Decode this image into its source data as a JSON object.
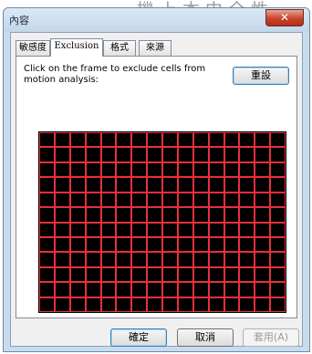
{
  "background_text": "機上本中全性",
  "window": {
    "title": "內容",
    "close_glyph": "✕"
  },
  "tabs": [
    {
      "label": "敏感度",
      "active": false
    },
    {
      "label": "Exclusion",
      "active": true
    },
    {
      "label": "格式",
      "active": false
    },
    {
      "label": "來源",
      "active": false
    }
  ],
  "exclusion": {
    "instructions": "Click on the frame to exclude cells from motion analysis:",
    "reset_label": "重設",
    "grid": {
      "columns": 16,
      "rows": 12,
      "cell_color": "#000000",
      "line_color": "#e8303a",
      "excluded_cells": 0
    }
  },
  "footer": {
    "ok_label": "確定",
    "cancel_label": "取消",
    "apply_label": "套用(A)"
  }
}
